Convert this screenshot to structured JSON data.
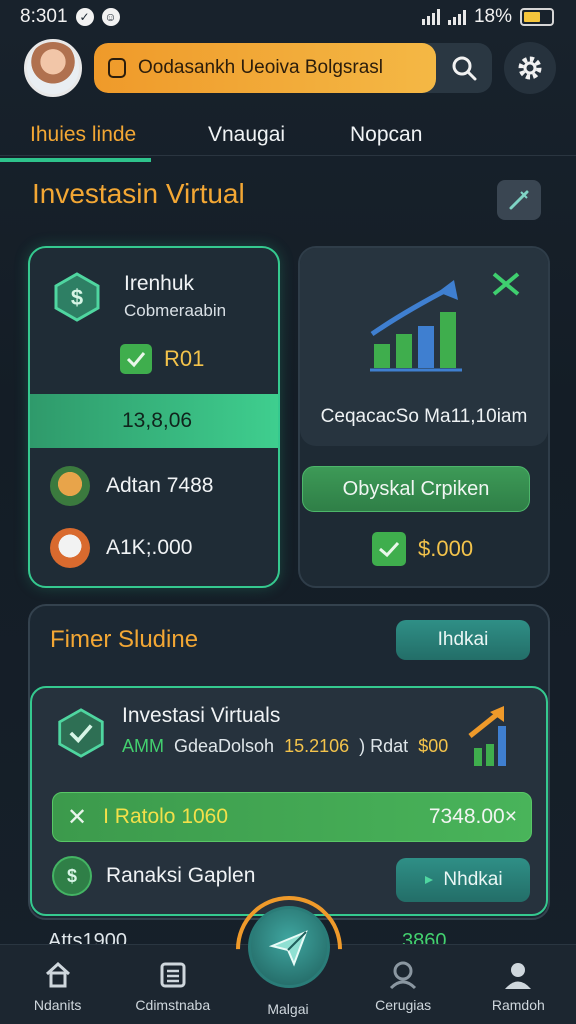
{
  "status_bar": {
    "time": "8:301",
    "battery": "18%"
  },
  "header": {
    "search_text": "Oodasankh Ueoiva Bolgsrasl"
  },
  "tabs": [
    {
      "label": "Ihuies linde",
      "active": true
    },
    {
      "label": "Vnaugai",
      "active": false
    },
    {
      "label": "Nopcan",
      "active": false
    }
  ],
  "section": {
    "title": "Investasin Virtual"
  },
  "card1": {
    "title": "Irenhuk",
    "subtitle": "Cobmeraabin",
    "badge_value": "R01",
    "band_value": "13,8,06",
    "rows": [
      {
        "label": "Adtan 7488"
      },
      {
        "label": "A1K;.000"
      }
    ]
  },
  "card2": {
    "label": "CeqacacSo Ma11,10iam",
    "button": "Obyskal Crpiken",
    "value": "$.000"
  },
  "card3": {
    "title": "Fimer Sludine",
    "button": "Ihdkai",
    "inner": {
      "name": "Investasi Virtuals",
      "line_green": "AMM",
      "line_white": "GdeaDolsoh",
      "line_yellow": "15.2106",
      "line_white2": ") Rdat",
      "line_yellow2": "$00",
      "bar_label": "I Ratolo 1060",
      "bar_amount": "7348.00×",
      "row_label": "Ranaksi Gaplen",
      "row_button": "Nhdkai"
    }
  },
  "peek": {
    "left": "Atts1900",
    "right": "3860"
  },
  "bottom_nav": [
    {
      "label": "Ndanits",
      "icon": "home-icon"
    },
    {
      "label": "Cdimstnaba",
      "icon": "list-icon"
    },
    {
      "label": "Malgai",
      "icon": "send-icon"
    },
    {
      "label": "Cerugias",
      "icon": "search-person-icon"
    },
    {
      "label": "Ramdoh",
      "icon": "profile-icon"
    }
  ],
  "colors": {
    "accent_orange": "#f3a734",
    "accent_green": "#35c98f",
    "bg": "#18222c",
    "value_yellow": "#f3c34b"
  }
}
